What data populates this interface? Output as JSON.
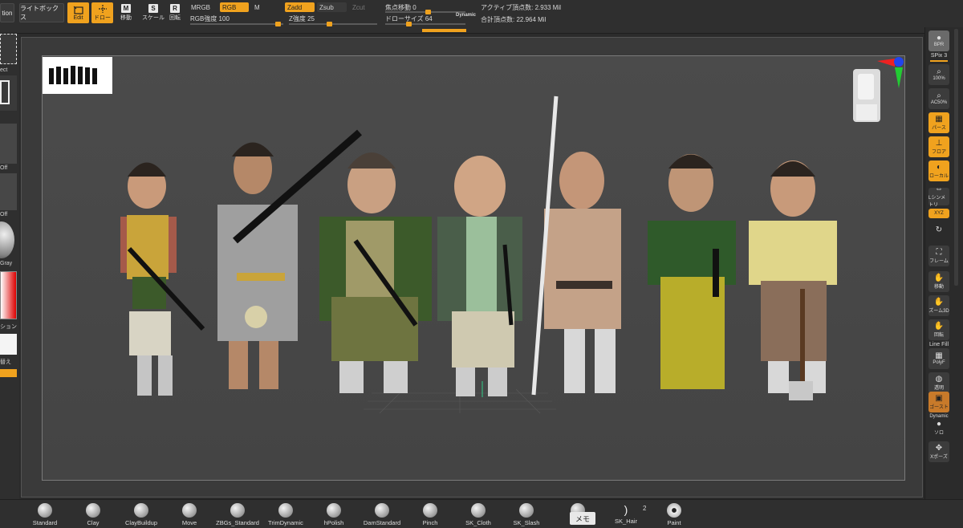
{
  "topbar": {
    "menu_fragment": "tion",
    "lightbox_label": "ライトボックス",
    "edit_label": "Edit",
    "draw_label": "ドロー",
    "move_label": "移動",
    "scale_label": "スケール",
    "rotate_label": "回転",
    "move_key": "M",
    "scale_key": "S",
    "rotate_key": "R",
    "mrgb_label": "MRGB",
    "rgb_label": "RGB",
    "m_label": "M",
    "zadd_label": "Zadd",
    "zsub_label": "Zsub",
    "zcut_label": "Zcut",
    "rgb_intensity_label": "RGB強度 100",
    "rgb_intensity_value": 100,
    "z_intensity_label": "Z強度 25",
    "z_intensity_value": 25,
    "focal_shift_label": "焦点移動 0",
    "focal_shift_value": 0,
    "draw_size_label": "ドローサイズ 64",
    "draw_size_value": 64,
    "dynamic_label": "Dynamic",
    "active_points": "アクティブ頂点数: 2.933 Mil",
    "total_points": "合計頂点数: 22.964 Mil"
  },
  "leftpanel": {
    "select_label": "ect",
    "off1": "Off",
    "off2": "Off",
    "gray_label": "Gray",
    "gradient_label": "ション",
    "swap_label": "替え"
  },
  "rightpanel": {
    "bpr_label": "BPR",
    "spix_label": "SPix 3",
    "actual_label": "100%",
    "aahalf_label": "AC50%",
    "persp_label": "パース",
    "floor_label": "フロア",
    "local_label": "ローカル",
    "lsym_label": "Lシンメトリ",
    "xyz_label": "XYZ",
    "frame_label": "フレーム",
    "move_label": "移動",
    "zoom3d_label": "ズーム3D",
    "rotate_label": "回転",
    "linefill_label": "Line Fill",
    "polyf_label": "PolyF",
    "transp_label": "透明",
    "ghost_label": "ゴースト",
    "dynamic_label": "Dynamic",
    "solo_label": "ソロ",
    "xpose_label": "Xポーズ"
  },
  "brushes": [
    {
      "label": "Standard"
    },
    {
      "label": "Clay"
    },
    {
      "label": "ClayBuildup"
    },
    {
      "label": "Move"
    },
    {
      "label": "ZBGs_Standard"
    },
    {
      "label": "TrimDynamic"
    },
    {
      "label": "hPolish"
    },
    {
      "label": "DamStandard"
    },
    {
      "label": "Pinch"
    },
    {
      "label": "SK_Cloth"
    },
    {
      "label": "SK_Slash"
    },
    {
      "label": "SK_Hair"
    },
    {
      "label": "Paint"
    }
  ],
  "memo_label": "メモ",
  "hair_count": "2",
  "colors": {
    "accent": "#f0a21e",
    "panel": "#2f2f2f",
    "canvas": "#4a4a4a"
  }
}
